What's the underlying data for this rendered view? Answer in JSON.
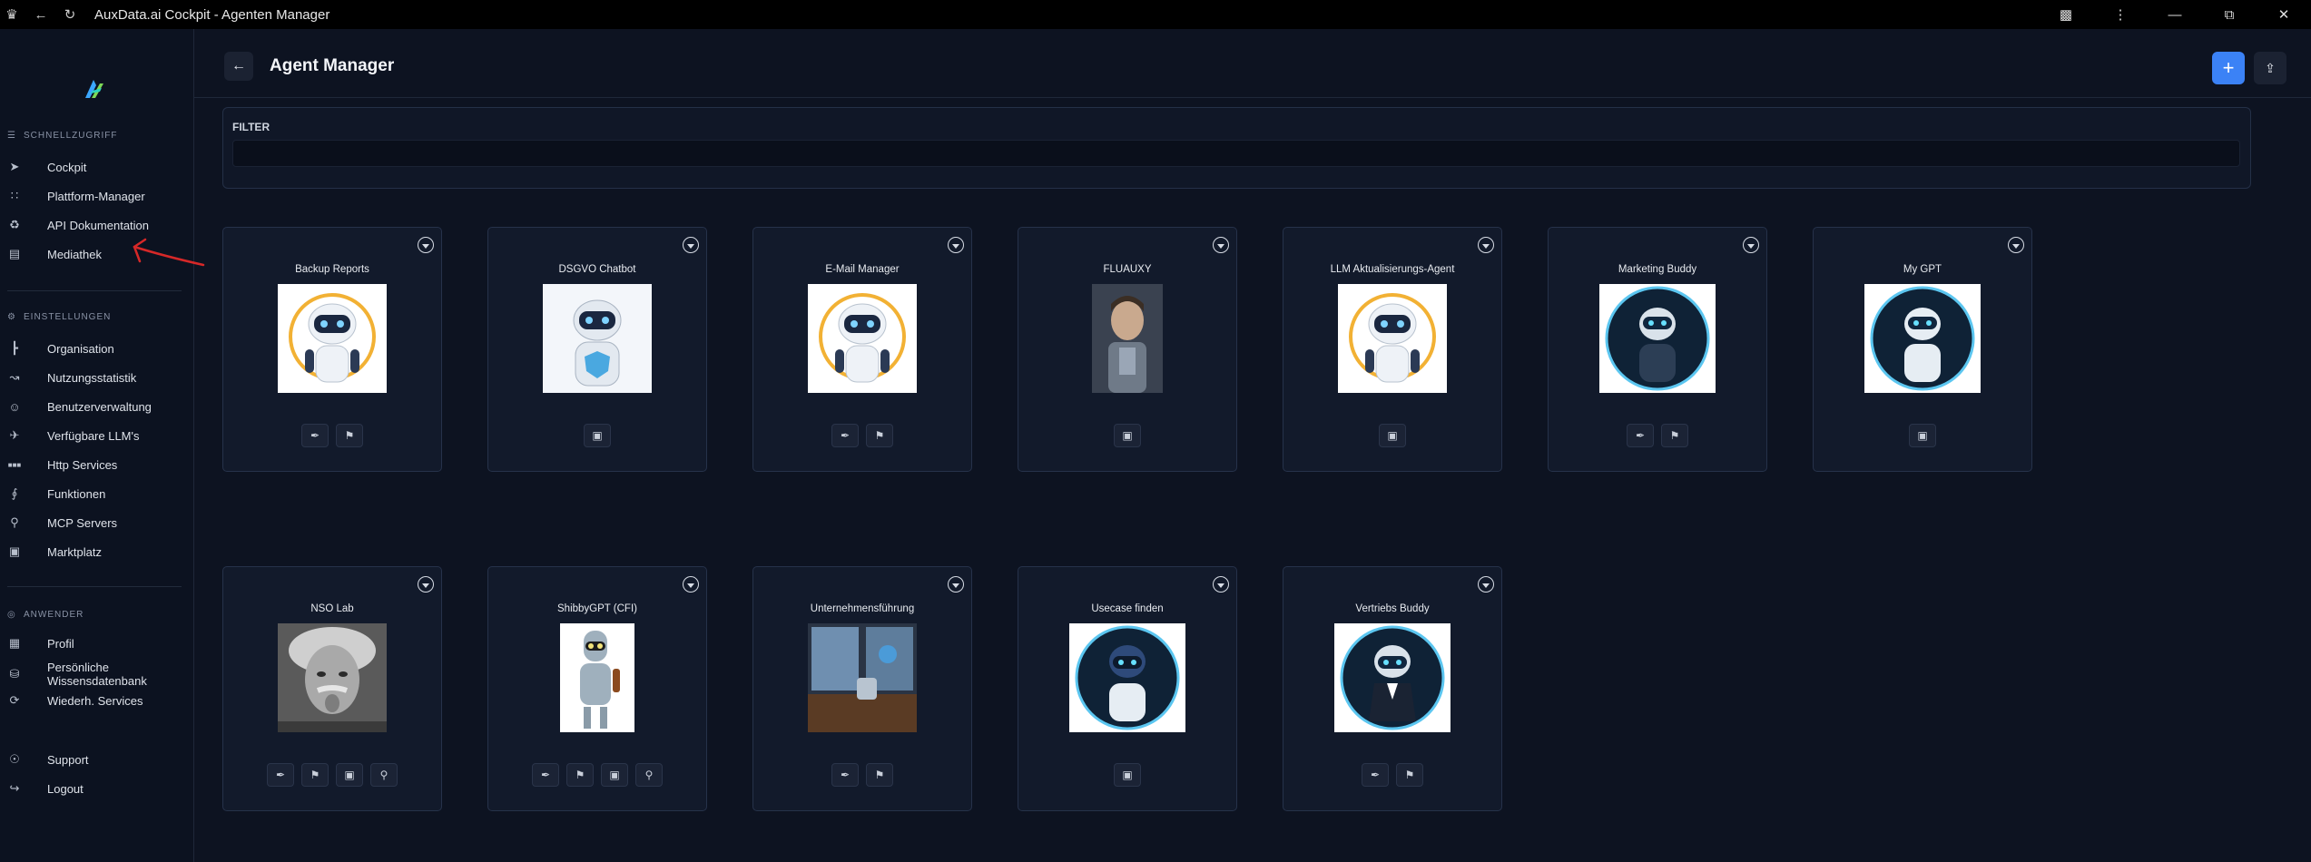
{
  "window": {
    "title": "AuxData.ai Cockpit - Agenten Manager"
  },
  "sidebar": {
    "sections": [
      {
        "heading": "SCHNELLZUGRIFF",
        "icon": "menu-icon",
        "items": [
          {
            "label": "Cockpit",
            "icon": "rocket-icon"
          },
          {
            "label": "Plattform-Manager",
            "icon": "grid-icon"
          },
          {
            "label": "API Dokumentation",
            "icon": "api-icon"
          },
          {
            "label": "Mediathek",
            "icon": "media-icon"
          }
        ]
      },
      {
        "heading": "EINSTELLUNGEN",
        "icon": "gear-icon",
        "items": [
          {
            "label": "Organisation",
            "icon": "org-icon"
          },
          {
            "label": "Nutzungsstatistik",
            "icon": "stats-icon"
          },
          {
            "label": "Benutzerverwaltung",
            "icon": "users-icon"
          },
          {
            "label": "Verfügbare LLM's",
            "icon": "plane-icon"
          },
          {
            "label": "Http Services",
            "icon": "http-icon"
          },
          {
            "label": "Funktionen",
            "icon": "function-icon"
          },
          {
            "label": "MCP Servers",
            "icon": "server-icon"
          },
          {
            "label": "Marktplatz",
            "icon": "store-icon"
          }
        ]
      },
      {
        "heading": "ANWENDER",
        "icon": "user-circle-icon",
        "items": [
          {
            "label": "Profil",
            "icon": "profile-icon"
          },
          {
            "label": "Persönliche Wissensdatenbank",
            "line1": "Persönliche",
            "line2": "Wissensdatenbank",
            "icon": "database-icon"
          },
          {
            "label": "Wiederh. Services",
            "icon": "refresh-icon"
          },
          {
            "label": "Support",
            "icon": "support-icon"
          },
          {
            "label": "Logout",
            "icon": "logout-icon"
          }
        ]
      }
    ]
  },
  "header": {
    "title": "Agent Manager"
  },
  "filter": {
    "label": "FILTER",
    "value": ""
  },
  "agents": [
    {
      "name": "Backup Reports",
      "avatar": "robot-headset",
      "actions": [
        "brush",
        "flag"
      ]
    },
    {
      "name": "DSGVO Chatbot",
      "avatar": "robot-shield",
      "actions": [
        "chat"
      ]
    },
    {
      "name": "E-Mail Manager",
      "avatar": "robot-headset",
      "actions": [
        "brush",
        "flag"
      ]
    },
    {
      "name": "FLUAUXY",
      "avatar": "cyborg",
      "actions": [
        "chat"
      ]
    },
    {
      "name": "LLM Aktualisierungs-Agent",
      "avatar": "robot-headset",
      "actions": [
        "chat"
      ]
    },
    {
      "name": "Marketing Buddy",
      "avatar": "robot-round",
      "actions": [
        "brush",
        "flag"
      ]
    },
    {
      "name": "My GPT",
      "avatar": "robot-round",
      "actions": [
        "chat"
      ]
    },
    {
      "name": "NSO Lab",
      "avatar": "photo-portrait",
      "actions": [
        "brush",
        "flag",
        "chat",
        "search"
      ]
    },
    {
      "name": "ShibbyGPT (CFI)",
      "avatar": "robot-bender",
      "actions": [
        "brush",
        "flag",
        "chat",
        "search"
      ]
    },
    {
      "name": "Unternehmensführung",
      "avatar": "office",
      "actions": [
        "brush",
        "flag"
      ]
    },
    {
      "name": "Usecase finden",
      "avatar": "robot-round",
      "actions": [
        "chat"
      ]
    },
    {
      "name": "Vertriebs Buddy",
      "avatar": "robot-suit",
      "actions": [
        "brush",
        "flag"
      ]
    }
  ]
}
